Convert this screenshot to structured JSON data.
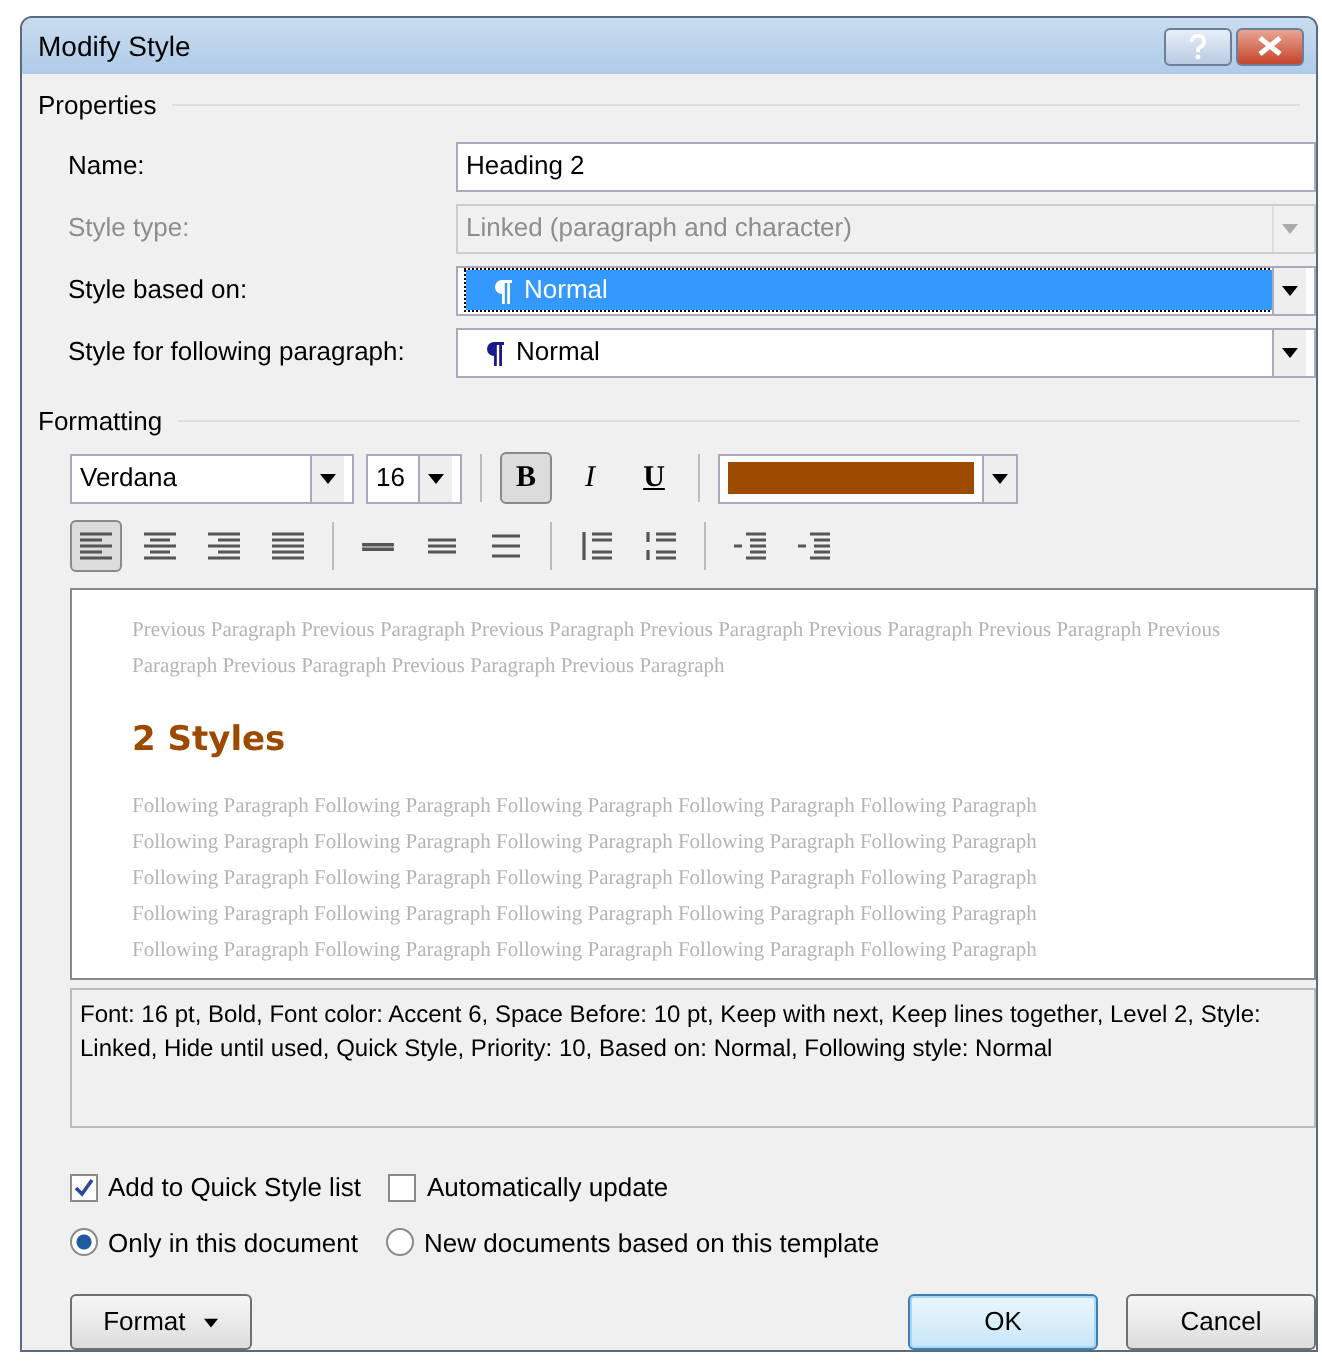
{
  "window": {
    "title": "Modify Style"
  },
  "properties": {
    "heading": "Properties",
    "fields": [
      {
        "label": "Name:",
        "kind": "text",
        "value": "Heading 2",
        "disabled": false,
        "selected": false
      },
      {
        "label": "Style type:",
        "kind": "combo",
        "value": "Linked (paragraph and character)",
        "disabled": true,
        "selected": false
      },
      {
        "label": "Style based on:",
        "kind": "style-combo",
        "value": "Normal",
        "disabled": false,
        "selected": true
      },
      {
        "label": "Style for following paragraph:",
        "kind": "style-combo",
        "value": "Normal",
        "disabled": false,
        "selected": false
      }
    ]
  },
  "formatting": {
    "heading": "Formatting",
    "font": "Verdana",
    "size": "16",
    "style_buttons": [
      {
        "kind": "bold",
        "label": "B",
        "on": true
      },
      {
        "kind": "italic",
        "label": "I",
        "on": false
      },
      {
        "kind": "underline",
        "label": "U",
        "on": false
      }
    ],
    "color": "#9c4a00",
    "tool_groups": [
      [
        {
          "kind": "align-left",
          "selected": true
        },
        {
          "kind": "align-center",
          "selected": false
        },
        {
          "kind": "align-right",
          "selected": false
        },
        {
          "kind": "justify",
          "selected": false
        }
      ],
      [
        {
          "kind": "single-spacing",
          "selected": false
        },
        {
          "kind": "one-half-spacing",
          "selected": false
        },
        {
          "kind": "double-spacing",
          "selected": false
        }
      ],
      [
        {
          "kind": "space-increase",
          "selected": false
        },
        {
          "kind": "space-decrease",
          "selected": false
        }
      ],
      [
        {
          "kind": "indent-decrease",
          "selected": false
        },
        {
          "kind": "indent-increase",
          "selected": false
        }
      ]
    ]
  },
  "preview": {
    "previous": "Previous Paragraph Previous Paragraph Previous Paragraph Previous Paragraph Previous Paragraph Previous Paragraph Previous Paragraph Previous Paragraph Previous Paragraph Previous Paragraph",
    "heading": "2 Styles",
    "following": [
      "Following Paragraph Following Paragraph Following Paragraph Following Paragraph Following Paragraph",
      "Following Paragraph Following Paragraph Following Paragraph Following Paragraph Following Paragraph",
      "Following Paragraph Following Paragraph Following Paragraph Following Paragraph Following Paragraph",
      "Following Paragraph Following Paragraph Following Paragraph Following Paragraph Following Paragraph",
      "Following Paragraph Following Paragraph Following Paragraph Following Paragraph Following Paragraph"
    ]
  },
  "description": "Font: 16 pt, Bold, Font color: Accent 6, Space Before:  10 pt, Keep with next, Keep lines together, Level 2, Style: Linked, Hide until used, Quick Style, Priority: 10, Based on: Normal, Following style: Normal",
  "checkboxes": [
    {
      "label": "Add to Quick Style list",
      "checked": true
    },
    {
      "label": "Automatically update",
      "checked": false
    }
  ],
  "radios": [
    {
      "label": "Only in this document",
      "selected": true
    },
    {
      "label": "New documents based on this template",
      "selected": false
    }
  ],
  "buttons": [
    {
      "label": "Format",
      "kind": "menu",
      "default": false
    },
    {
      "label": "OK",
      "kind": "plain",
      "default": true
    },
    {
      "label": "Cancel",
      "kind": "plain",
      "default": false
    }
  ]
}
